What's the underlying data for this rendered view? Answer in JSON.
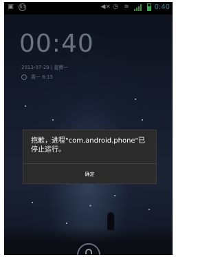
{
  "statusbar": {
    "left_icons": [
      "usb-icon",
      "notification-badge-icon"
    ],
    "notification_badge": "80",
    "right_icons": [
      "mute-icon",
      "alarm-clock-icon",
      "wifi-icon",
      "signal-icon",
      "battery-icon"
    ],
    "time": "0:40"
  },
  "lockscreen": {
    "clock": "00:40",
    "date": "2013-07-29 | 星期一",
    "alarm": "周一 6:15"
  },
  "dialog": {
    "message": "抱歉，进程\"com.android.phone\"已停止运行。",
    "ok_label": "确定"
  },
  "colors": {
    "dialog_bg": "#2b2b2b",
    "clock_text": "#6a7380",
    "status_time": "#3a8a9a"
  }
}
